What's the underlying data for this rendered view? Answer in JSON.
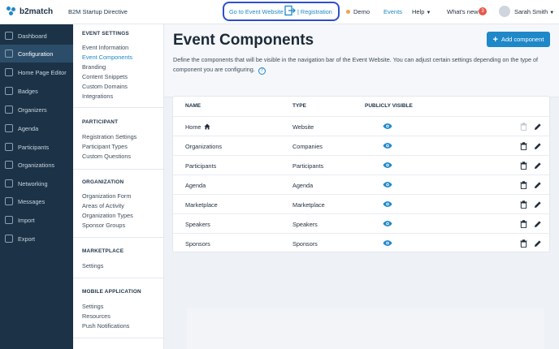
{
  "brand": {
    "name": "b2match",
    "color": "#1e88c8"
  },
  "topbar": {
    "event_name": "B2M Startup Directive",
    "go_to_website": "Go to Event Website",
    "registration": "| Registration",
    "demo": "Demo",
    "events": "Events",
    "help": "Help",
    "whats_new": "What's new",
    "whats_new_count": "3",
    "user_name": "Sarah Smith"
  },
  "sidebar": {
    "items": [
      {
        "label": "Dashboard",
        "icon": "dashboard-icon"
      },
      {
        "label": "Configuration",
        "icon": "wrench-icon",
        "active": true
      },
      {
        "label": "Home Page Editor",
        "icon": "browser-icon"
      },
      {
        "label": "Badges",
        "icon": "badge-icon"
      },
      {
        "label": "Organizers",
        "icon": "organizers-icon"
      },
      {
        "label": "Agenda",
        "icon": "calendar-icon"
      },
      {
        "label": "Participants",
        "icon": "people-icon"
      },
      {
        "label": "Organizations",
        "icon": "building-icon"
      },
      {
        "label": "Networking",
        "icon": "network-icon"
      },
      {
        "label": "Messages",
        "icon": "envelope-icon"
      },
      {
        "label": "Import",
        "icon": "import-icon"
      },
      {
        "label": "Export",
        "icon": "export-icon"
      }
    ]
  },
  "subnav": {
    "event_settings": {
      "heading": "EVENT SETTINGS",
      "items": [
        "Event Information",
        "Event Components",
        "Branding",
        "Content Snippets",
        "Custom Domains",
        "Integrations"
      ]
    },
    "participant": {
      "heading": "PARTICIPANT",
      "items": [
        "Registration Settings",
        "Participant Types",
        "Custom Questions"
      ]
    },
    "organization": {
      "heading": "ORGANIZATION",
      "items": [
        "Organization Form",
        "Areas of Activity",
        "Organization Types",
        "Sponsor Groups"
      ]
    },
    "marketplace": {
      "heading": "MARKETPLACE",
      "items": [
        "Settings"
      ]
    },
    "mobile": {
      "heading": "MOBILE APPLICATION",
      "items": [
        "Settings",
        "Resources",
        "Push Notifications"
      ]
    }
  },
  "main": {
    "title": "Event Components",
    "description": "Define the components that will be visible in the navigation bar of the Event Website. You can adjust certain settings depending on the type of component you are configuring.",
    "add_button": "Add component",
    "table": {
      "headers": {
        "name": "NAME",
        "type": "TYPE",
        "visible": "PUBLICLY VISIBLE"
      },
      "rows": [
        {
          "name": "Home",
          "type": "Website",
          "home": true
        },
        {
          "name": "Organizations",
          "type": "Companies"
        },
        {
          "name": "Participants",
          "type": "Participants"
        },
        {
          "name": "Agenda",
          "type": "Agenda"
        },
        {
          "name": "Marketplace",
          "type": "Marketplace"
        },
        {
          "name": "Speakers",
          "type": "Speakers"
        },
        {
          "name": "Sponsors",
          "type": "Sponsors"
        }
      ]
    }
  },
  "colors": {
    "sidebar_bg": "#1c3347",
    "sidebar_active": "#2b4d69",
    "accent": "#1e88c8",
    "highlight_border": "#2e4fd0",
    "demo_dot": "#f0a34a",
    "notification": "#e55a4a"
  }
}
